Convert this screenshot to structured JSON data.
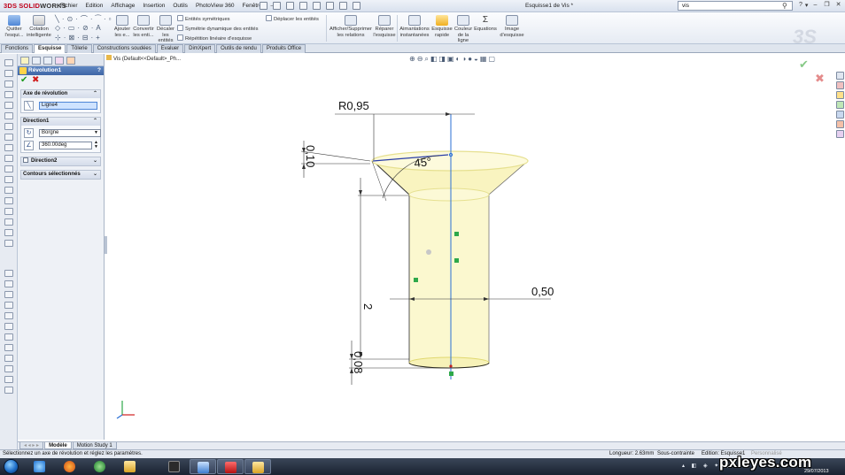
{
  "app": {
    "logo_ds": "3DS",
    "logo_text_solid": "SOLID",
    "logo_text_works": "WORKS",
    "document_title": "Esquisse1 de Vis *",
    "search_value": "vis",
    "menu": [
      "Fichier",
      "Edition",
      "Affichage",
      "Insertion",
      "Outils",
      "PhotoView 360",
      "Fenêtre"
    ],
    "menu_pin": "⊣"
  },
  "ribbon": {
    "quit_sketch": "Quitter l'esqui...",
    "smart_dim": "Cotation intelligente",
    "add_relation": "Ajouter les e...",
    "convert": "Convertir les enti...",
    "offset": "Décaler les entités",
    "mirror": "Entités symétriques",
    "dyn_mirror": "Symétrie dynamique des entités",
    "linear_pattern": "Répétition linéaire d'esquisse",
    "move_entities": "Déplacer les entités",
    "show_relations": "Afficher/Supprimer les relations",
    "repair": "Réparer l'esquisse",
    "snaps": "Aimantations instantanées",
    "rapid_sketch": "Esquisse rapide",
    "line_color": "Couleur de la ligne",
    "equations": "Equations",
    "sketch_picture": "Image d'esquisse"
  },
  "tabs": [
    "Fonctions",
    "Esquisse",
    "Tôlerie",
    "Constructions soudées",
    "Evaluer",
    "DimXpert",
    "Outils de rendu",
    "Produits Office"
  ],
  "active_tab": "Esquisse",
  "property_manager": {
    "title": "Révolution1",
    "help": "?",
    "ok": "✔",
    "cancel": "✖",
    "axis_group": "Axe de révolution",
    "axis_value": "Ligne4",
    "dir1_group": "Direction1",
    "dir1_type": "Borgne",
    "dir1_angle": "360.00deg",
    "dir2_group": "Direction2",
    "contours_group": "Contours sélectionnés"
  },
  "graphics": {
    "tree_label": "Vis  (Default<<Default>_Ph...",
    "dim_radius": "R0,95",
    "dim_head_height": "0,10",
    "dim_angle": "45°",
    "dim_length": "2",
    "dim_diameter": "0,50",
    "dim_tip": "0,08"
  },
  "model_tabs": [
    "Modèle",
    "Motion Study 1"
  ],
  "active_model_tab": "Modèle",
  "status": {
    "message": "Sélectionnez un axe de révolution et réglez les paramètres.",
    "length": "Longueur: 2.63mm",
    "state": "Sous-contrainte",
    "editing": "Edition: Esquisse1",
    "units": "Personnalisé"
  },
  "taskbar": {
    "clock_time": "",
    "date": "29/07/2013"
  },
  "watermark": {
    "site": "pxleyes.com",
    "date": "29/07/2013"
  },
  "colors": {
    "accent": "#3f66a6",
    "model_fill": "#fbf8cf",
    "model_edge": "#e6e090",
    "axis_blue": "#2a6fd6",
    "ok_green": "#1c9a1c",
    "cancel_red": "#d01a1a"
  }
}
